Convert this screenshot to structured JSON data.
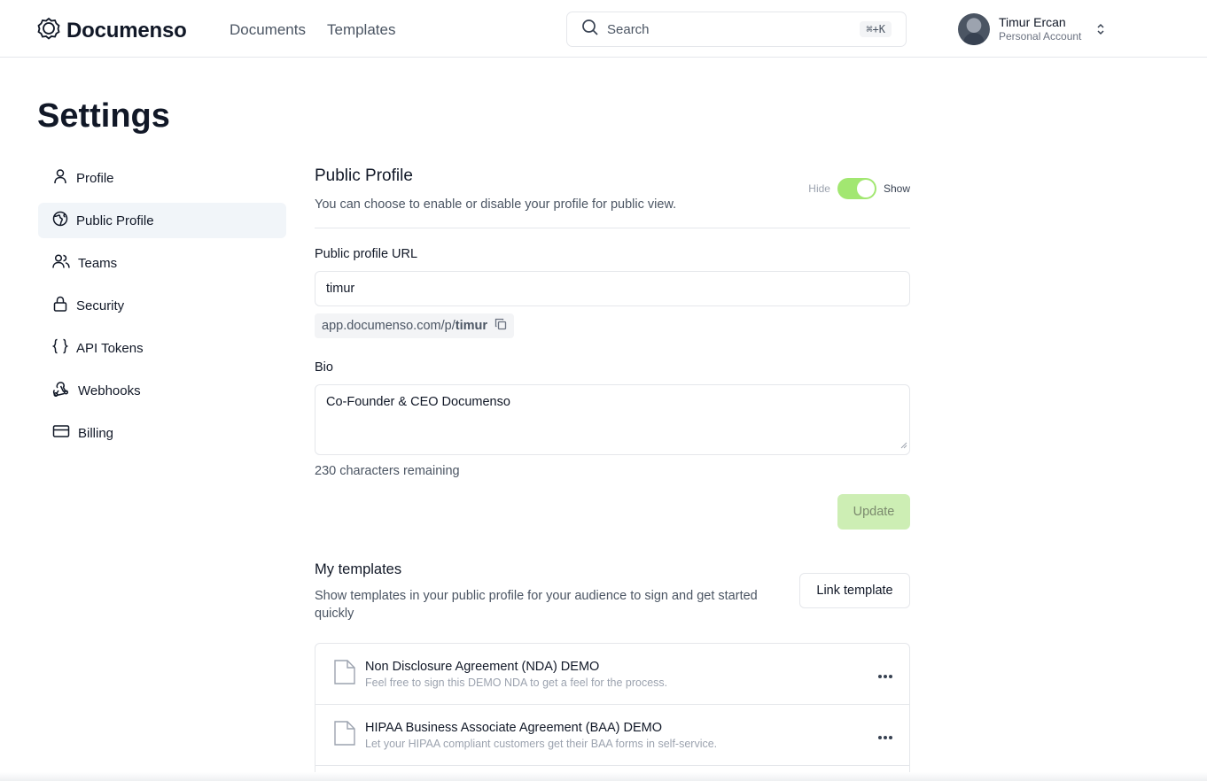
{
  "header": {
    "app_name": "Documenso",
    "nav": [
      "Documents",
      "Templates"
    ],
    "search": {
      "label": "Search",
      "shortcut": "⌘+K"
    },
    "user": {
      "name": "Timur Ercan",
      "account": "Personal Account"
    }
  },
  "page_title": "Settings",
  "sidebar": {
    "items": [
      {
        "label": "Profile",
        "icon": "user-icon",
        "active": false
      },
      {
        "label": "Public Profile",
        "icon": "globe-icon",
        "active": true
      },
      {
        "label": "Teams",
        "icon": "users-icon",
        "active": false
      },
      {
        "label": "Security",
        "icon": "lock-icon",
        "active": false
      },
      {
        "label": "API Tokens",
        "icon": "braces-icon",
        "active": false
      },
      {
        "label": "Webhooks",
        "icon": "webhook-icon",
        "active": false
      },
      {
        "label": "Billing",
        "icon": "credit-card-icon",
        "active": false
      }
    ]
  },
  "public_profile": {
    "title": "Public Profile",
    "description": "You can choose to enable or disable your profile for public view.",
    "toggle": {
      "off_label": "Hide",
      "on_label": "Show",
      "enabled": true
    },
    "url_label": "Public profile URL",
    "url_value": "timur",
    "url_prefix": "app.documenso.com/p/",
    "url_slug": "timur",
    "bio_label": "Bio",
    "bio_value": "Co-Founder & CEO Documenso",
    "remaining": "230 characters remaining",
    "update_label": "Update"
  },
  "templates": {
    "title": "My templates",
    "description": "Show templates in your public profile for your audience to sign and get started quickly",
    "link_label": "Link template",
    "items": [
      {
        "title": "Non Disclosure Agreement (NDA) DEMO",
        "subtitle": "Feel free to sign this DEMO NDA to get a feel for the process."
      },
      {
        "title": "HIPAA Business Associate Agreement (BAA) DEMO",
        "subtitle": "Let your HIPAA compliant customers get their BAA forms in self-service."
      }
    ]
  },
  "colors": {
    "accent": "#a2e771",
    "accent_disabled": "#cdeeb4"
  }
}
